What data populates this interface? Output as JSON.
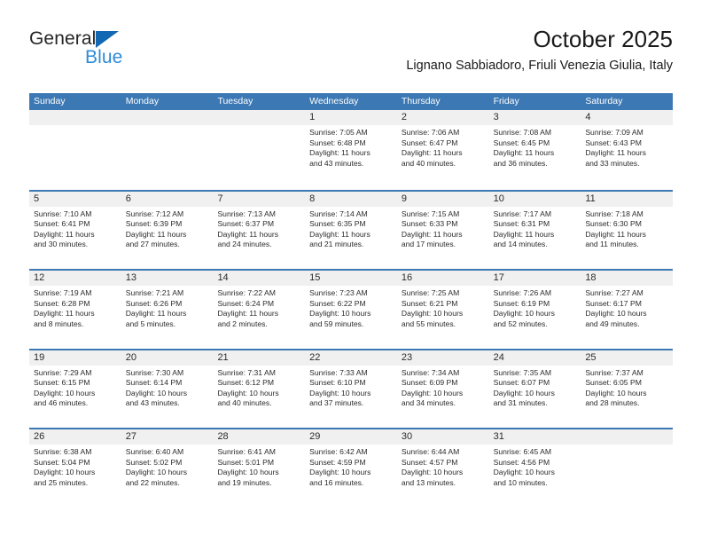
{
  "brand": {
    "name_part1": "General",
    "name_part2": "Blue",
    "accent_color": "#1268b3",
    "accent_color_light": "#2e8bd8"
  },
  "header": {
    "title": "October 2025",
    "subtitle": "Lignano Sabbiadoro, Friuli Venezia Giulia, Italy"
  },
  "theme": {
    "header_blue": "#3c78b4",
    "day_band_gray": "#f0f0f0",
    "text_color": "#2b2b2b"
  },
  "calendar": {
    "weekdays": [
      "Sunday",
      "Monday",
      "Tuesday",
      "Wednesday",
      "Thursday",
      "Friday",
      "Saturday"
    ],
    "weeks": [
      [
        {
          "day": "",
          "lines": []
        },
        {
          "day": "",
          "lines": []
        },
        {
          "day": "",
          "lines": []
        },
        {
          "day": "1",
          "lines": [
            "Sunrise: 7:05 AM",
            "Sunset: 6:48 PM",
            "Daylight: 11 hours",
            "and 43 minutes."
          ]
        },
        {
          "day": "2",
          "lines": [
            "Sunrise: 7:06 AM",
            "Sunset: 6:47 PM",
            "Daylight: 11 hours",
            "and 40 minutes."
          ]
        },
        {
          "day": "3",
          "lines": [
            "Sunrise: 7:08 AM",
            "Sunset: 6:45 PM",
            "Daylight: 11 hours",
            "and 36 minutes."
          ]
        },
        {
          "day": "4",
          "lines": [
            "Sunrise: 7:09 AM",
            "Sunset: 6:43 PM",
            "Daylight: 11 hours",
            "and 33 minutes."
          ]
        }
      ],
      [
        {
          "day": "5",
          "lines": [
            "Sunrise: 7:10 AM",
            "Sunset: 6:41 PM",
            "Daylight: 11 hours",
            "and 30 minutes."
          ]
        },
        {
          "day": "6",
          "lines": [
            "Sunrise: 7:12 AM",
            "Sunset: 6:39 PM",
            "Daylight: 11 hours",
            "and 27 minutes."
          ]
        },
        {
          "day": "7",
          "lines": [
            "Sunrise: 7:13 AM",
            "Sunset: 6:37 PM",
            "Daylight: 11 hours",
            "and 24 minutes."
          ]
        },
        {
          "day": "8",
          "lines": [
            "Sunrise: 7:14 AM",
            "Sunset: 6:35 PM",
            "Daylight: 11 hours",
            "and 21 minutes."
          ]
        },
        {
          "day": "9",
          "lines": [
            "Sunrise: 7:15 AM",
            "Sunset: 6:33 PM",
            "Daylight: 11 hours",
            "and 17 minutes."
          ]
        },
        {
          "day": "10",
          "lines": [
            "Sunrise: 7:17 AM",
            "Sunset: 6:31 PM",
            "Daylight: 11 hours",
            "and 14 minutes."
          ]
        },
        {
          "day": "11",
          "lines": [
            "Sunrise: 7:18 AM",
            "Sunset: 6:30 PM",
            "Daylight: 11 hours",
            "and 11 minutes."
          ]
        }
      ],
      [
        {
          "day": "12",
          "lines": [
            "Sunrise: 7:19 AM",
            "Sunset: 6:28 PM",
            "Daylight: 11 hours",
            "and 8 minutes."
          ]
        },
        {
          "day": "13",
          "lines": [
            "Sunrise: 7:21 AM",
            "Sunset: 6:26 PM",
            "Daylight: 11 hours",
            "and 5 minutes."
          ]
        },
        {
          "day": "14",
          "lines": [
            "Sunrise: 7:22 AM",
            "Sunset: 6:24 PM",
            "Daylight: 11 hours",
            "and 2 minutes."
          ]
        },
        {
          "day": "15",
          "lines": [
            "Sunrise: 7:23 AM",
            "Sunset: 6:22 PM",
            "Daylight: 10 hours",
            "and 59 minutes."
          ]
        },
        {
          "day": "16",
          "lines": [
            "Sunrise: 7:25 AM",
            "Sunset: 6:21 PM",
            "Daylight: 10 hours",
            "and 55 minutes."
          ]
        },
        {
          "day": "17",
          "lines": [
            "Sunrise: 7:26 AM",
            "Sunset: 6:19 PM",
            "Daylight: 10 hours",
            "and 52 minutes."
          ]
        },
        {
          "day": "18",
          "lines": [
            "Sunrise: 7:27 AM",
            "Sunset: 6:17 PM",
            "Daylight: 10 hours",
            "and 49 minutes."
          ]
        }
      ],
      [
        {
          "day": "19",
          "lines": [
            "Sunrise: 7:29 AM",
            "Sunset: 6:15 PM",
            "Daylight: 10 hours",
            "and 46 minutes."
          ]
        },
        {
          "day": "20",
          "lines": [
            "Sunrise: 7:30 AM",
            "Sunset: 6:14 PM",
            "Daylight: 10 hours",
            "and 43 minutes."
          ]
        },
        {
          "day": "21",
          "lines": [
            "Sunrise: 7:31 AM",
            "Sunset: 6:12 PM",
            "Daylight: 10 hours",
            "and 40 minutes."
          ]
        },
        {
          "day": "22",
          "lines": [
            "Sunrise: 7:33 AM",
            "Sunset: 6:10 PM",
            "Daylight: 10 hours",
            "and 37 minutes."
          ]
        },
        {
          "day": "23",
          "lines": [
            "Sunrise: 7:34 AM",
            "Sunset: 6:09 PM",
            "Daylight: 10 hours",
            "and 34 minutes."
          ]
        },
        {
          "day": "24",
          "lines": [
            "Sunrise: 7:35 AM",
            "Sunset: 6:07 PM",
            "Daylight: 10 hours",
            "and 31 minutes."
          ]
        },
        {
          "day": "25",
          "lines": [
            "Sunrise: 7:37 AM",
            "Sunset: 6:05 PM",
            "Daylight: 10 hours",
            "and 28 minutes."
          ]
        }
      ],
      [
        {
          "day": "26",
          "lines": [
            "Sunrise: 6:38 AM",
            "Sunset: 5:04 PM",
            "Daylight: 10 hours",
            "and 25 minutes."
          ]
        },
        {
          "day": "27",
          "lines": [
            "Sunrise: 6:40 AM",
            "Sunset: 5:02 PM",
            "Daylight: 10 hours",
            "and 22 minutes."
          ]
        },
        {
          "day": "28",
          "lines": [
            "Sunrise: 6:41 AM",
            "Sunset: 5:01 PM",
            "Daylight: 10 hours",
            "and 19 minutes."
          ]
        },
        {
          "day": "29",
          "lines": [
            "Sunrise: 6:42 AM",
            "Sunset: 4:59 PM",
            "Daylight: 10 hours",
            "and 16 minutes."
          ]
        },
        {
          "day": "30",
          "lines": [
            "Sunrise: 6:44 AM",
            "Sunset: 4:57 PM",
            "Daylight: 10 hours",
            "and 13 minutes."
          ]
        },
        {
          "day": "31",
          "lines": [
            "Sunrise: 6:45 AM",
            "Sunset: 4:56 PM",
            "Daylight: 10 hours",
            "and 10 minutes."
          ]
        },
        {
          "day": "",
          "lines": []
        }
      ]
    ]
  }
}
